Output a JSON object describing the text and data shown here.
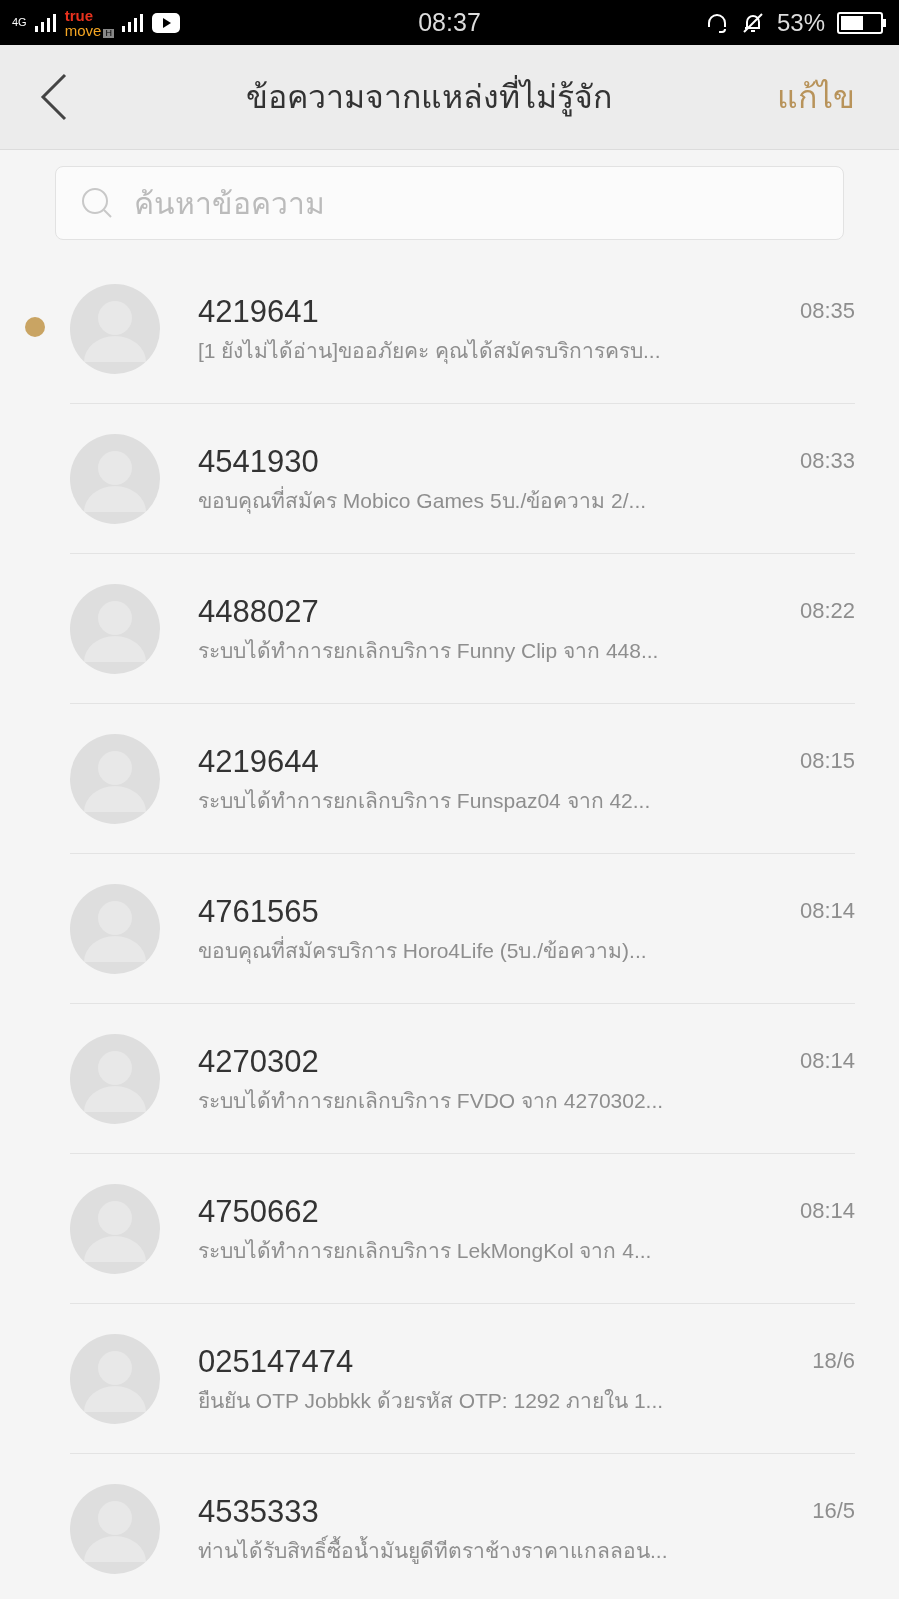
{
  "status_bar": {
    "network": "4G",
    "carrier_top": "true",
    "carrier_bottom": "move",
    "carrier_badge": "H",
    "time": "08:37",
    "battery": "53%"
  },
  "header": {
    "title": "ข้อความจากแหล่งที่ไม่รู้จัก",
    "action": "แก้ไข"
  },
  "search": {
    "placeholder": "ค้นหาข้อความ"
  },
  "messages": [
    {
      "sender": "4219641",
      "preview": "[1 ยังไม่ได้อ่าน]ขออภัยคะ คุณได้สมัครบริการครบ...",
      "time": "08:35",
      "unread": true
    },
    {
      "sender": "4541930",
      "preview": "ขอบคุณที่สมัคร Mobico Games  5บ./ข้อความ 2/...",
      "time": "08:33",
      "unread": false
    },
    {
      "sender": "4488027",
      "preview": "ระบบได้ทำการยกเลิกบริการ Funny Clip จาก 448...",
      "time": "08:22",
      "unread": false
    },
    {
      "sender": "4219644",
      "preview": "ระบบได้ทำการยกเลิกบริการ Funspaz04 จาก 42...",
      "time": "08:15",
      "unread": false
    },
    {
      "sender": "4761565",
      "preview": "ขอบคุณที่สมัครบริการ Horo4Life (5บ./ข้อความ)...",
      "time": "08:14",
      "unread": false
    },
    {
      "sender": "4270302",
      "preview": "ระบบได้ทำการยกเลิกบริการ FVDO จาก 4270302...",
      "time": "08:14",
      "unread": false
    },
    {
      "sender": "4750662",
      "preview": "ระบบได้ทำการยกเลิกบริการ LekMongKol จาก 4...",
      "time": "08:14",
      "unread": false
    },
    {
      "sender": "025147474",
      "preview": "ยืนยัน OTP Jobbkk ด้วยรหัส OTP: 1292 ภายใน 1...",
      "time": "18/6",
      "unread": false
    },
    {
      "sender": "4535333",
      "preview": "ท่านได้รับสิทธิ์ซื้อน้ำมันยูดีทีตราช้างราคาแกลลอน...",
      "time": "16/5",
      "unread": false
    }
  ]
}
